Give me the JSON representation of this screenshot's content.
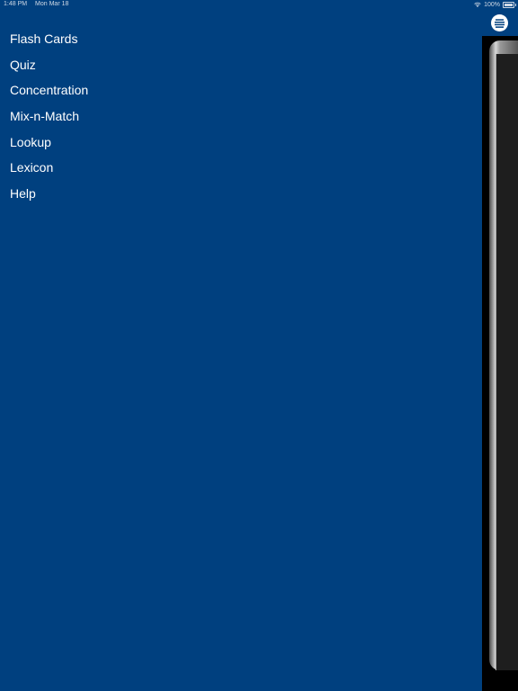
{
  "status_bar": {
    "time": "1:48 PM",
    "date": "Mon Mar 18",
    "battery": "100%"
  },
  "menu": {
    "items": [
      {
        "label": "Flash Cards"
      },
      {
        "label": "Quiz"
      },
      {
        "label": "Concentration"
      },
      {
        "label": "Mix-n-Match"
      },
      {
        "label": "Lookup"
      },
      {
        "label": "Lexicon"
      },
      {
        "label": "Help"
      }
    ]
  },
  "icons": {
    "menu_toggle": "hamburger-menu-icon",
    "wifi": "wifi-icon",
    "battery": "battery-icon"
  },
  "colors": {
    "drawer_background": "#00407f",
    "text": "#ffffff",
    "content_background": "#000000"
  }
}
